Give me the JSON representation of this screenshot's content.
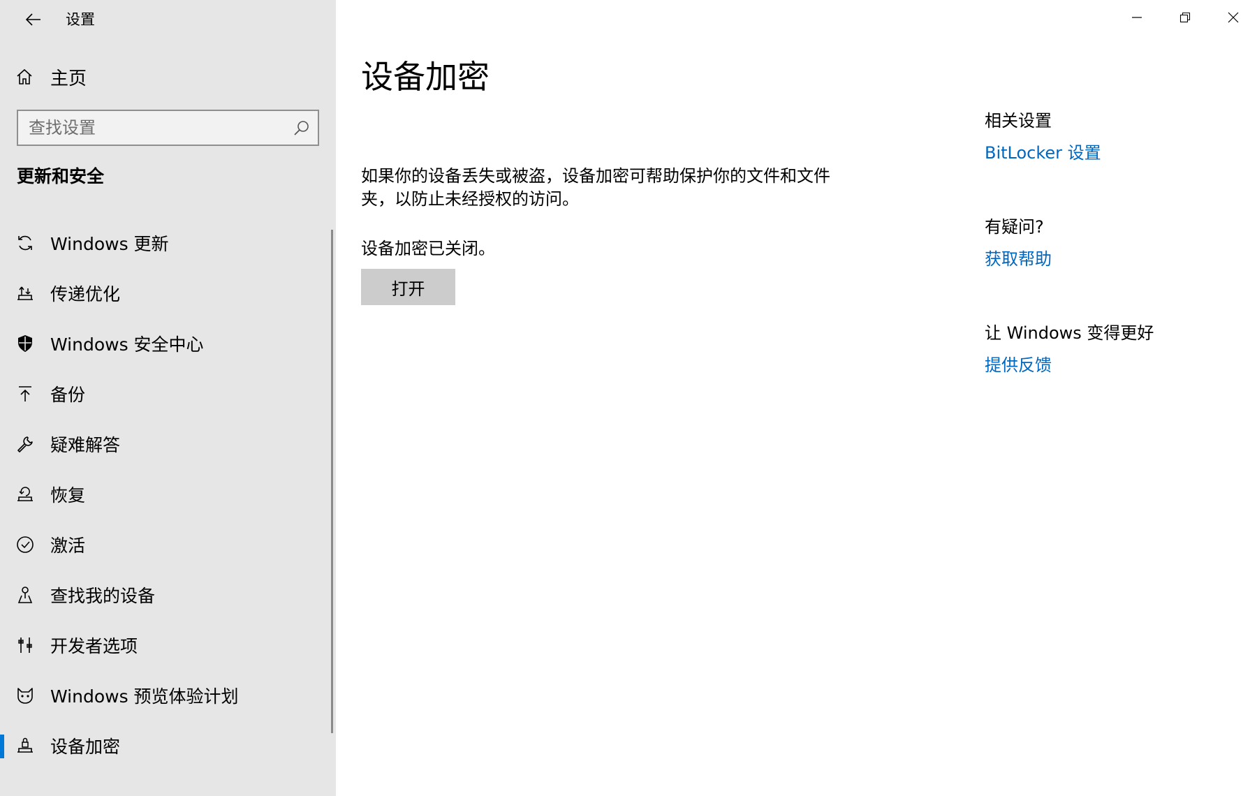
{
  "window": {
    "app_title": "设置",
    "controls": {
      "minimize_icon": "minimize-icon",
      "restore_icon": "restore-icon",
      "close_icon": "close-icon"
    }
  },
  "sidebar": {
    "back_icon": "back-arrow-icon",
    "home": {
      "label": "主页",
      "icon": "home-icon"
    },
    "search": {
      "placeholder": "查找设置",
      "value": "",
      "icon": "search-icon"
    },
    "section_title": "更新和安全",
    "items": [
      {
        "label": "Windows 更新",
        "icon": "sync-icon",
        "selected": false
      },
      {
        "label": "传递优化",
        "icon": "delivery-optimization-icon",
        "selected": false
      },
      {
        "label": "Windows 安全中心",
        "icon": "shield-icon",
        "selected": false
      },
      {
        "label": "备份",
        "icon": "backup-arrow-icon",
        "selected": false
      },
      {
        "label": "疑难解答",
        "icon": "wrench-icon",
        "selected": false
      },
      {
        "label": "恢复",
        "icon": "recovery-icon",
        "selected": false
      },
      {
        "label": "激活",
        "icon": "check-circle-icon",
        "selected": false
      },
      {
        "label": "查找我的设备",
        "icon": "person-location-icon",
        "selected": false
      },
      {
        "label": "开发者选项",
        "icon": "developer-tools-icon",
        "selected": false
      },
      {
        "label": "Windows 预览体验计划",
        "icon": "insider-cat-icon",
        "selected": false
      },
      {
        "label": "设备加密",
        "icon": "device-encryption-icon",
        "selected": true
      }
    ]
  },
  "main": {
    "page_title": "设备加密",
    "description": "如果你的设备丢失或被盗，设备加密可帮助保护你的文件和文件夹，以防止未经授权的访问。",
    "status": "设备加密已关闭。",
    "turn_on_button": "打开"
  },
  "related": {
    "settings_heading": "相关设置",
    "bitlocker_link": "BitLocker 设置",
    "questions_heading": "有疑问?",
    "help_link": "获取帮助",
    "improve_heading": "让 Windows 变得更好",
    "feedback_link": "提供反馈"
  },
  "colors": {
    "sidebar_bg": "#e6e6e6",
    "accent": "#0078d7",
    "link": "#0067c0",
    "button_bg": "#cccccc"
  }
}
